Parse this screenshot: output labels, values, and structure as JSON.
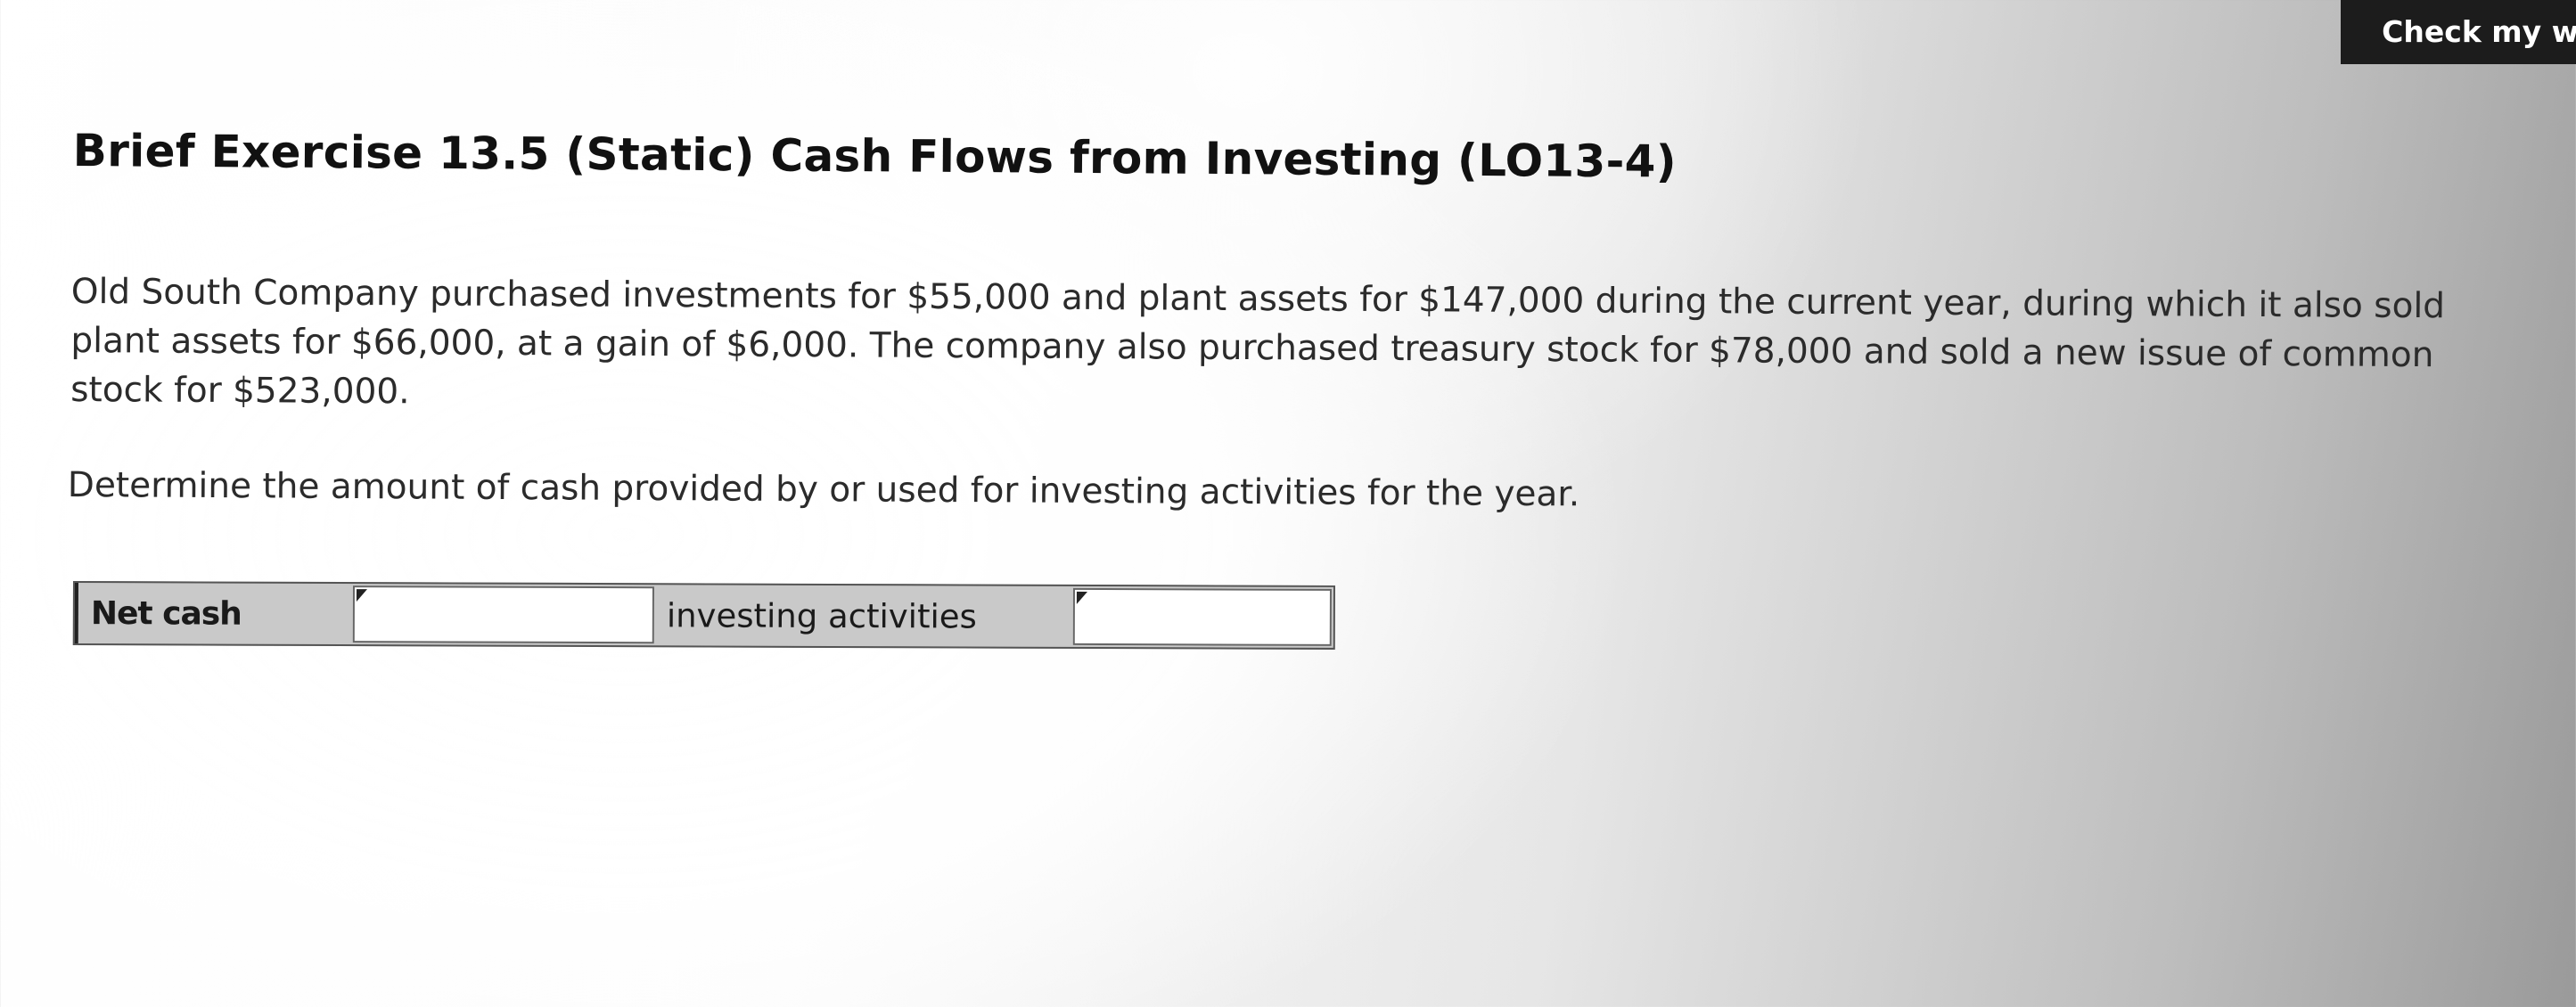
{
  "header": {
    "check_button_label": "Check my wo"
  },
  "exercise": {
    "title": "Brief Exercise 13.5 (Static) Cash Flows from Investing (LO13-4)",
    "problem_text": "Old South Company purchased investments for $55,000 and plant assets for $147,000 during the current year, during which it also sold plant assets for $66,000, at a gain of $6,000. The company also purchased treasury stock for $78,000 and sold a new issue of common stock for $523,000.",
    "instruction": "Determine the amount of cash provided by or used for investing activities for the year."
  },
  "answer_row": {
    "label_1": "Net cash",
    "dropdown_value": "",
    "label_2": "investing activities",
    "amount_value": ""
  }
}
